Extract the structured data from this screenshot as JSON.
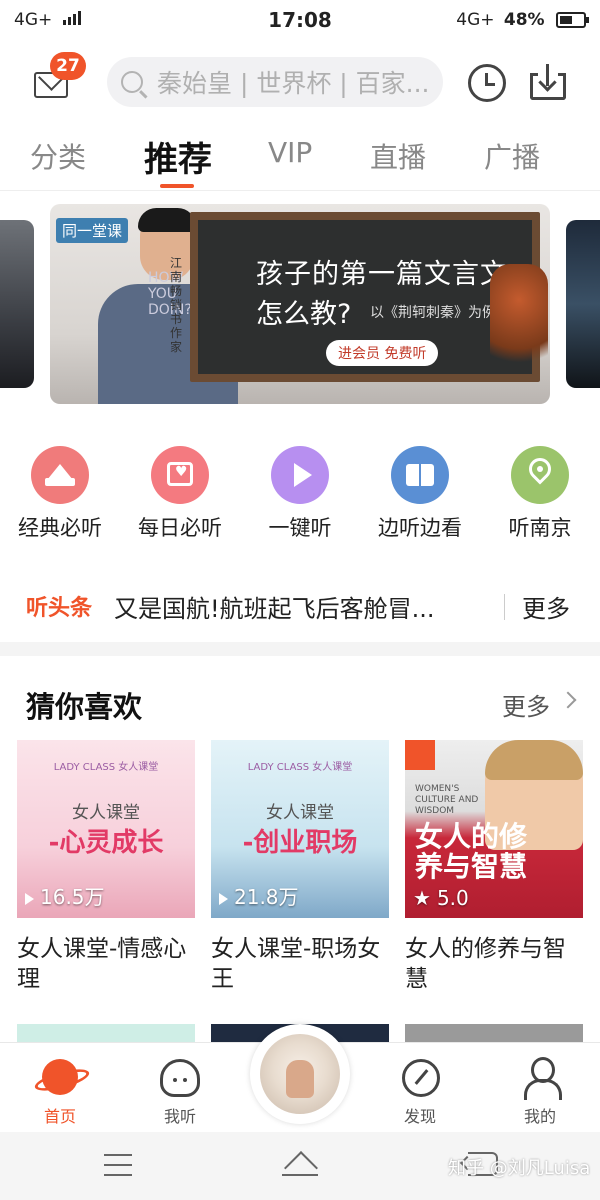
{
  "status_bar": {
    "network_left": "4G+",
    "time": "17:08",
    "network_right": "4G+",
    "battery": "48%"
  },
  "header": {
    "mail_badge": "27",
    "search_placeholder": "秦始皇 | 世界杯 | 百家...",
    "icons": [
      "mail-icon",
      "search-icon",
      "history-icon",
      "download-icon"
    ]
  },
  "tabs": [
    {
      "label": "分类",
      "active": false
    },
    {
      "label": "推荐",
      "active": true
    },
    {
      "label": "VIP",
      "active": false
    },
    {
      "label": "直播",
      "active": false
    },
    {
      "label": "广播",
      "active": false
    }
  ],
  "banner": {
    "series_tag": "同一堂课",
    "author": "江南 畅销书作家",
    "headline_line1": "孩子的第一篇文言文",
    "headline_line2": "怎么教?",
    "example": "以《荆轲刺秦》为例",
    "cta": "进会员 免费听",
    "shirt_text": "HOW YOU DOIN?"
  },
  "quick_actions": [
    {
      "label": "经典必听",
      "icon": "crown-icon",
      "color": "#f07b7b"
    },
    {
      "label": "每日必听",
      "icon": "calendar-heart-icon",
      "color": "#f47a80"
    },
    {
      "label": "一键听",
      "icon": "play-icon",
      "color": "#b78ff0"
    },
    {
      "label": "边听边看",
      "icon": "book-icon",
      "color": "#5a8fd4"
    },
    {
      "label": "听南京",
      "icon": "location-pin-icon",
      "color": "#9bc46b"
    }
  ],
  "headline_ticker": {
    "tag": "听头条",
    "text": "又是国航!航班起飞后客舱冒...",
    "more": "更多"
  },
  "recommend": {
    "title": "猜你喜欢",
    "more": "更多",
    "cards": [
      {
        "cover_brand": "LADY CLASS 女人课堂",
        "cover_line1": "女人课堂",
        "cover_line2": "-心灵成长",
        "stat": "16.5万",
        "stat_icon": "play-icon",
        "title": "女人课堂-情感心理"
      },
      {
        "cover_brand": "LADY CLASS 女人课堂",
        "cover_line1": "女人课堂",
        "cover_line2": "-创业职场",
        "stat": "21.8万",
        "stat_icon": "play-icon",
        "title": "女人课堂-职场女王"
      },
      {
        "cover_english": "WOMEN'S CULTURE AND WISDOM",
        "cover_book_title": "女人的修养与智慧",
        "stat": "5.0",
        "stat_icon": "star-icon",
        "title": "女人的修养与智慧"
      }
    ]
  },
  "bottom_nav": [
    {
      "label": "首页",
      "icon": "planet-icon",
      "active": true
    },
    {
      "label": "我听",
      "icon": "headphones-icon",
      "active": false
    },
    {
      "label": "发现",
      "icon": "compass-icon",
      "active": false
    },
    {
      "label": "我的",
      "icon": "person-icon",
      "active": false
    }
  ],
  "watermark": "知乎 @刘凡Luisa",
  "colors": {
    "accent": "#f0542a"
  }
}
